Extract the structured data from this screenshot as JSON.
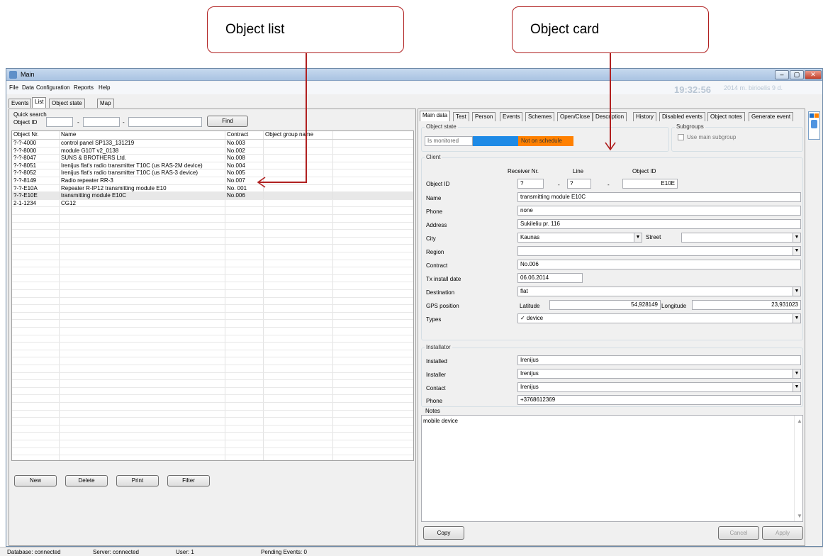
{
  "callouts": {
    "object_list": "Object list",
    "object_card": "Object card"
  },
  "window": {
    "title": "Main",
    "clock": "19:32:56",
    "date": "2014 m. birioelis 9 d.",
    "menu": [
      "File",
      "Data",
      "Configuration",
      "Reports",
      "Help"
    ],
    "tabs": [
      "Events",
      "List",
      "Object state",
      "Map"
    ]
  },
  "search": {
    "title": "Quick search",
    "object_id_label": "Object ID",
    "sep1": "-",
    "sep2": "-",
    "find_label": "Find"
  },
  "table": {
    "headers": [
      "Object Nr.",
      "Name",
      "Contract",
      "Object group name"
    ],
    "rows": [
      [
        "?-?-4000",
        "control panel SP133_131219",
        "No.003",
        ""
      ],
      [
        "?-?-8000",
        "module G10T v2_0138",
        "No.002",
        ""
      ],
      [
        "?-?-8047",
        "SUNS & BROTHERS Ltd.",
        "No.008",
        ""
      ],
      [
        "?-?-8051",
        "Irenijus flat's radio transmitter T10C (us RAS-2M device)",
        "No.004",
        ""
      ],
      [
        "?-?-8052",
        "Irenijus flat's radio transmitter T10C (us RAS-3 device)",
        "No.005",
        ""
      ],
      [
        "?-?-8149",
        "Radio repeater RR-3",
        "No.007",
        ""
      ],
      [
        "?-?-E10A",
        "Repeater R-IP12 transmitting module E10",
        "No. 001",
        ""
      ],
      [
        "?-?-E10E",
        "transmitting module E10C",
        "No.006",
        ""
      ],
      [
        "2-1-1234",
        "CG12",
        "",
        ""
      ]
    ]
  },
  "list_buttons": {
    "new": "New",
    "delete": "Delete",
    "print": "Print",
    "filter": "Filter"
  },
  "card": {
    "tabs": [
      "Main data",
      "Test",
      "Person",
      "Events",
      "Schemes",
      "Open/Close",
      "Description",
      "History",
      "Disabled events",
      "Object notes",
      "Generate event"
    ],
    "object_state": {
      "title": "Object state",
      "monitored": "Is monitored",
      "schedule": "Not on schedule",
      "colors": {
        "middle": "#1e8ae6",
        "schedule": "#ff8000"
      }
    },
    "subgroups": {
      "title": "Subgroups",
      "use_main": "Use main subgroup"
    },
    "client": {
      "title": "Client",
      "receiver_hdr": "Receiver Nr.",
      "line_hdr": "Line",
      "objid_hdr": "Object ID",
      "object_id_label": "Object ID",
      "receiver": "?",
      "line": "?",
      "object_id": "E10E",
      "dot1": "-",
      "dot2": "-",
      "name_label": "Name",
      "name": "transmitting module E10C",
      "phone_label": "Phone",
      "phone": "none",
      "address_label": "Address",
      "address": "Sukileliu pr. 116",
      "city_label": "City",
      "city": "Kaunas",
      "street_label": "Street",
      "street": "",
      "region_label": "Region",
      "region": "",
      "contract_label": "Contract",
      "contract": "No.006",
      "tx_label": "Tx install date",
      "tx_date": "06.06.2014",
      "destination_label": "Destination",
      "destination": "flat",
      "gps_label": "GPS position",
      "lat_label": "Latitude",
      "latitude": "54,928149",
      "lon_label": "Longitude",
      "longitude": "23,931023",
      "types_label": "Types",
      "types": "✓ device"
    },
    "installator": {
      "title": "Installator",
      "installed_label": "Installed",
      "installed": "Irenijus",
      "installer_label": "Installer",
      "installer": "Irenijus",
      "contact_label": "Contact",
      "contact": "Irenijus",
      "phone_label": "Phone",
      "phone": "+3768612369"
    },
    "notes": {
      "title": "Notes",
      "text": "mobile device"
    },
    "buttons": {
      "copy": "Copy",
      "cancel": "Cancel",
      "apply": "Apply"
    }
  },
  "status": {
    "database": "Database: connected",
    "server": "Server: connected",
    "user": "User: 1",
    "pending": "Pending Events: 0"
  }
}
